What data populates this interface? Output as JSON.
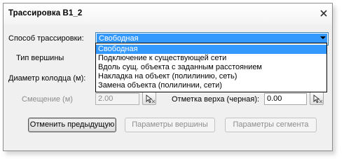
{
  "window": {
    "title": "Трассировка В1_2"
  },
  "form": {
    "method_label": "Способ трассировки:",
    "method_value": "Свободная",
    "vertex_type_label": "Тип вершины",
    "well_diameter_label": "Диаметр колодца (м):",
    "offset_label": "Смещение (м)",
    "offset_value": "2.00",
    "top_mark_label": "Отметка верха (черная):",
    "top_mark_value": "0.00"
  },
  "dropdown": {
    "options": [
      "Свободная",
      "Подключение к существующей сети",
      "Вдоль сущ. объекта с заданным расстоянием",
      "Накладка на объект (полилинию, сеть)",
      "Замена объекта (полилинии, сети)"
    ],
    "selected_index": 0
  },
  "buttons": {
    "undo_label": "Отменить предыдущую",
    "vertex_params_label": "Параметры вершины",
    "segment_params_label": "Параметры сегмента"
  },
  "colors": {
    "selection": "#3399ff",
    "disabled_text": "#8d8d8d"
  }
}
